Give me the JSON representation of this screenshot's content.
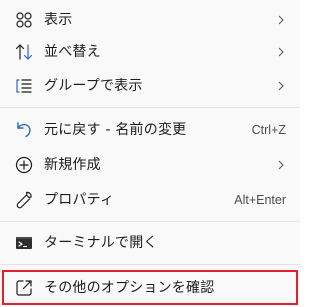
{
  "menu": {
    "items": [
      {
        "label": "表示",
        "icon": "grid-view-icon",
        "submenu": true
      },
      {
        "label": "並べ替え",
        "icon": "sort-icon",
        "submenu": true
      },
      {
        "label": "グループで表示",
        "icon": "group-list-icon",
        "submenu": true
      },
      {
        "label": "元に戻す - 名前の変更",
        "icon": "undo-icon",
        "shortcut": "Ctrl+Z"
      },
      {
        "label": "新規作成",
        "icon": "add-circle-icon",
        "submenu": true
      },
      {
        "label": "プロパティ",
        "icon": "wrench-icon",
        "shortcut": "Alt+Enter"
      },
      {
        "label": "ターミナルで開く",
        "icon": "terminal-icon"
      },
      {
        "label": "その他のオプションを確認",
        "icon": "external-open-icon",
        "highlighted": true
      }
    ]
  },
  "colors": {
    "menu_background": "#f9f9f9",
    "text": "#1c1c1c",
    "shortcut_text": "#4d4d4d",
    "accent_blue": "#2b66c6",
    "divider": "#e4e4e4",
    "highlight_border": "#e0212f"
  }
}
